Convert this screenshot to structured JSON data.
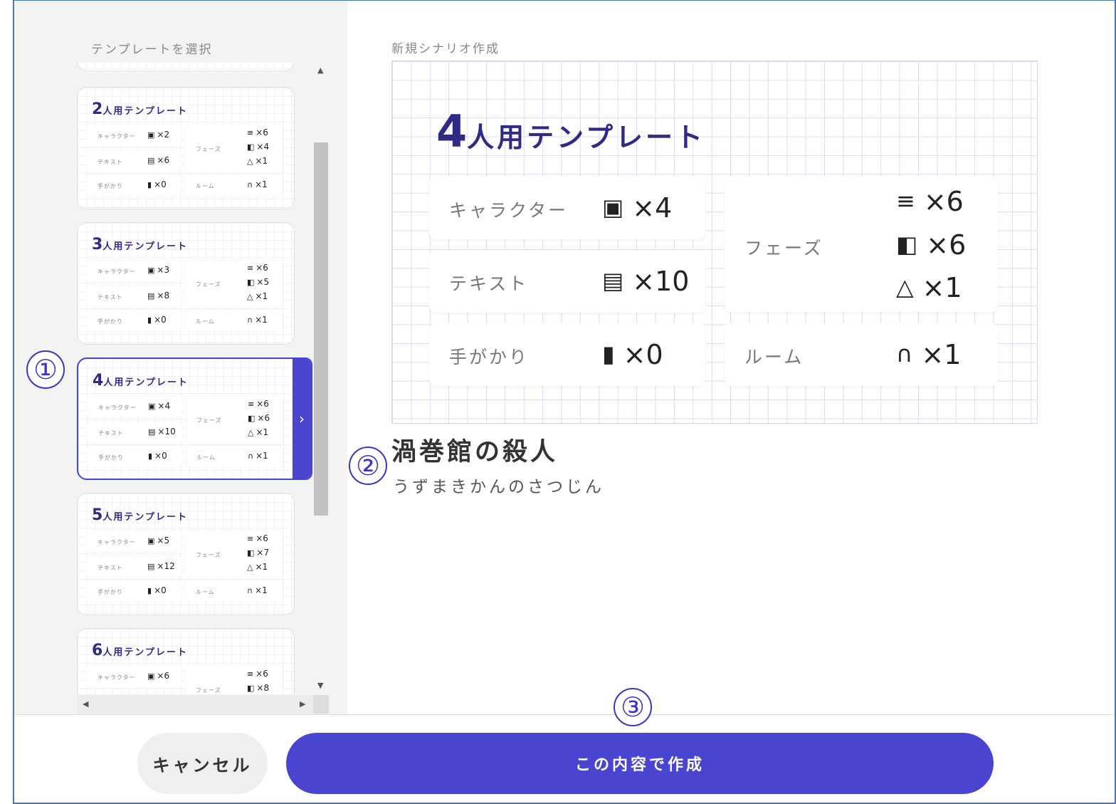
{
  "sidebar": {
    "title": "テンプレートを選択",
    "templates": [
      {
        "num": "2",
        "suffix": "人用テンプレート",
        "character": "×2",
        "text": "×6",
        "clue": "×0",
        "phase1": "×6",
        "phase2": "×4",
        "phase3": "×1",
        "room": "×1"
      },
      {
        "num": "3",
        "suffix": "人用テンプレート",
        "character": "×3",
        "text": "×8",
        "clue": "×0",
        "phase1": "×6",
        "phase2": "×5",
        "phase3": "×1",
        "room": "×1"
      },
      {
        "num": "4",
        "suffix": "人用テンプレート",
        "character": "×4",
        "text": "×10",
        "clue": "×0",
        "phase1": "×6",
        "phase2": "×6",
        "phase3": "×1",
        "room": "×1"
      },
      {
        "num": "5",
        "suffix": "人用テンプレート",
        "character": "×5",
        "text": "×12",
        "clue": "×0",
        "phase1": "×6",
        "phase2": "×7",
        "phase3": "×1",
        "room": "×1"
      },
      {
        "num": "6",
        "suffix": "人用テンプレート",
        "character": "×6",
        "phase1": "×6",
        "phase2": "×8"
      }
    ],
    "labels": {
      "character": "キャラクター",
      "text": "テキスト",
      "clue": "手がかり",
      "phase": "フェーズ",
      "room": "ルーム"
    },
    "selected_index": 2
  },
  "main": {
    "label": "新規シナリオ作成",
    "preview": {
      "num": "4",
      "suffix": "人用テンプレート",
      "character_label": "キャラクター",
      "character_value": "×4",
      "text_label": "テキスト",
      "text_value": "×10",
      "clue_label": "手がかり",
      "clue_value": "×0",
      "phase_label": "フェーズ",
      "phase_value1": "×6",
      "phase_value2": "×6",
      "phase_value3": "×1",
      "room_label": "ルーム",
      "room_value": "×1"
    },
    "scenario_title": "渦巻館の殺人",
    "scenario_reading": "うずまきかんのさつじん"
  },
  "footer": {
    "cancel_label": "キャンセル",
    "create_label": "この内容で作成"
  },
  "markers": [
    "①",
    "②",
    "③"
  ],
  "icons": {
    "character": "portrait-icon",
    "text": "clipboard-icon",
    "clue": "question-card-icon",
    "phase1": "lines-icon",
    "phase2": "book-icon",
    "phase3": "eraser-icon",
    "room": "headphones-icon"
  },
  "colors": {
    "accent": "#4a45d0",
    "title": "#2e2a86",
    "grid": "#dcdcf0"
  }
}
